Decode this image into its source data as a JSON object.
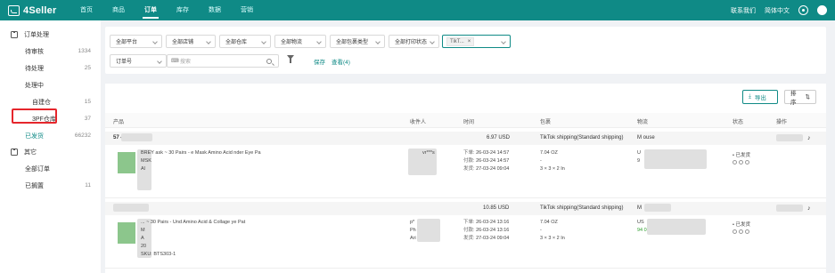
{
  "header": {
    "logo": "4Seller",
    "nav": [
      "首页",
      "商品",
      "订单",
      "库存",
      "数据",
      "营销"
    ],
    "active_nav": 2,
    "contact": "联系我们",
    "language": "简体中文"
  },
  "sidebar": {
    "section1": "订单处理",
    "items": [
      {
        "label": "待审核",
        "count": "1334"
      },
      {
        "label": "待处理",
        "count": "25"
      },
      {
        "label": "处理中",
        "count": ""
      }
    ],
    "sub_items": [
      {
        "label": "自建仓",
        "count": "15"
      },
      {
        "label": "3PF仓库",
        "count": "37"
      }
    ],
    "shipped": {
      "label": "已发货",
      "count": "66232"
    },
    "section2": "其它",
    "other_items": [
      {
        "label": "全部订单",
        "count": ""
      },
      {
        "label": "已搁置",
        "count": "11"
      }
    ]
  },
  "filters": {
    "dropdowns": [
      "全部平台",
      "全部店铺",
      "全部仓库",
      "全部物流",
      "全部包裹类型",
      "全部打印状态"
    ],
    "platform_tag": "TikT...",
    "order_no_label": "订单号",
    "search_placeholder": "搜索",
    "save": "保存",
    "view": "查看(4)"
  },
  "toolbar": {
    "export": "导出",
    "sort": "排序"
  },
  "table": {
    "headers": [
      "产品",
      "收件人",
      "时间",
      "包裹",
      "物流",
      "状态",
      "操作"
    ]
  },
  "orders": [
    {
      "id": "57 4239295",
      "amount": "6.97 USD",
      "shipping": "TikTok shipping(Standard shipping)",
      "logistics": "M ouse",
      "product": "BREY ask ~ 30 Pairs - e Mask Amino Acid nder Eye Pa",
      "msk": "MSK",
      "al": "Al",
      "recipient": "vr***s",
      "times": [
        {
          "k": "下单:",
          "v": "26-03-24 14:57"
        },
        {
          "k": "付款:",
          "v": "26-03-24 14:57"
        },
        {
          "k": "发货:",
          "v": "27-03-24 09:04"
        }
      ],
      "weight": "7.04 OZ",
      "dash": "-",
      "dims": "3 × 3 × 2 In",
      "tracking_prefix": "U",
      "tracking_num": "9",
      "status": "已发货"
    },
    {
      "id": "",
      "amount": "10.85 USD",
      "shipping": "TikTok shipping(Standard shipping)",
      "logistics": "M",
      "product": "... ~ 30 Pairs - Und Amino Acid & Collage ye Pat",
      "msk": "M",
      "al": "A",
      "extra": "20",
      "sku": "SKU: BTS303-1",
      "recipient": "p*",
      "recipient2": "Ph",
      "recipient3": "Ari",
      "times": [
        {
          "k": "下单:",
          "v": "26-03-24 13:16"
        },
        {
          "k": "付款:",
          "v": "26-03-24 13:16"
        },
        {
          "k": "发货:",
          "v": "27-03-24 09:04"
        }
      ],
      "weight": "7.04 OZ",
      "dash": "-",
      "dims": "3 × 3 × 2 In",
      "tracking_prefix": "US",
      "tracking_num": "94 0",
      "status": "已发货"
    }
  ],
  "colors": {
    "brand": "#0f8a86",
    "highlight": "#e5262c"
  }
}
